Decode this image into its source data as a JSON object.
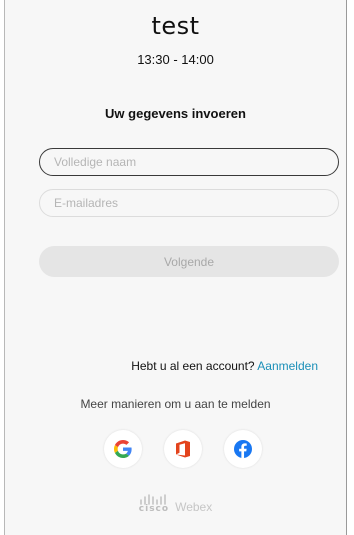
{
  "meeting": {
    "title": "test",
    "time": "13:30 - 14:00"
  },
  "form": {
    "heading": "Uw gegevens invoeren",
    "name_placeholder": "Volledige naam",
    "name_value": "",
    "email_placeholder": "E-mailadres",
    "email_value": "",
    "next_label": "Volgende"
  },
  "account": {
    "question": "Hebt u al een account?",
    "signin_link": "Aanmelden"
  },
  "social": {
    "more_ways": "Meer manieren om u aan te melden",
    "providers": [
      {
        "name": "google",
        "icon": "google-icon"
      },
      {
        "name": "office",
        "icon": "office-icon"
      },
      {
        "name": "facebook",
        "icon": "facebook-icon"
      }
    ]
  },
  "brand": {
    "logo_text": "cisco",
    "product": "Webex"
  },
  "colors": {
    "link": "#1a8fb8",
    "office_red": "#e3431c",
    "facebook_blue": "#1877f2"
  }
}
